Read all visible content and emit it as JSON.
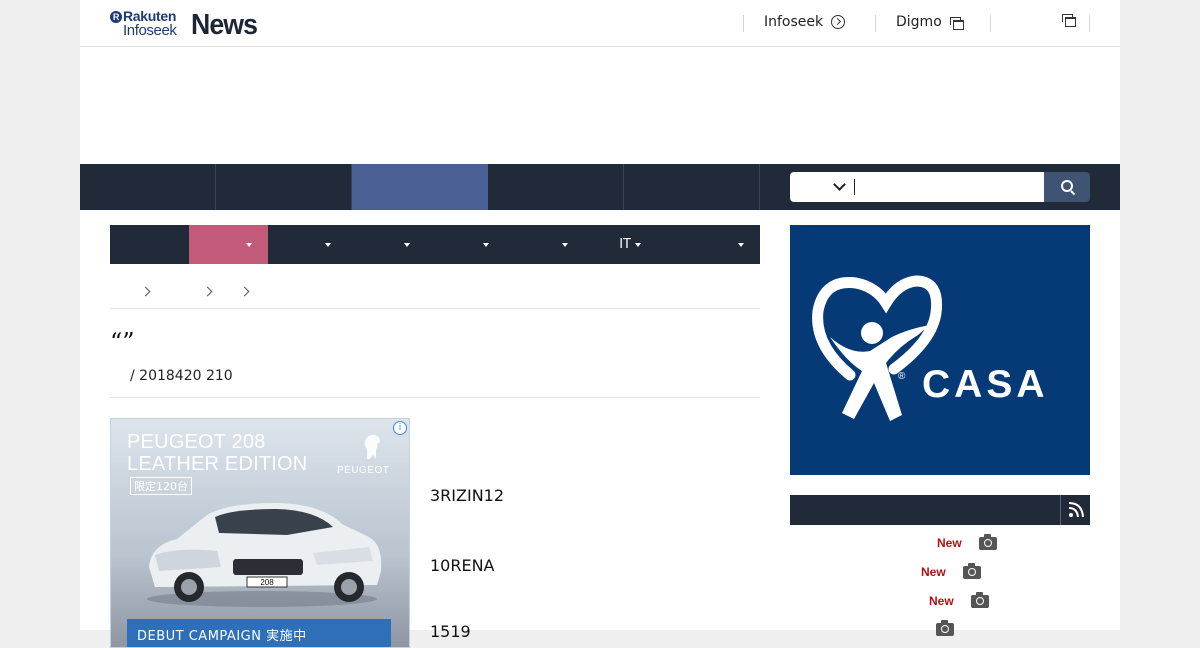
{
  "brand": {
    "rakuten": "Rakuten",
    "infoseek": "Infoseek",
    "news": "News"
  },
  "header": {
    "links": [
      {
        "label": "Infoseek",
        "icon": "circle-arrow-icon"
      },
      {
        "label": "Digmo",
        "icon": "external-window-icon"
      },
      {
        "label": "",
        "icon": "external-window-icon"
      }
    ]
  },
  "main_nav": {
    "tabs": [
      "",
      "",
      "",
      "",
      ""
    ],
    "active_index": 2
  },
  "search": {
    "placeholder": "",
    "selected_scope": ""
  },
  "sub_nav": {
    "items": [
      "",
      "",
      "",
      "",
      "",
      "",
      "IT",
      ""
    ],
    "active_index": 1
  },
  "breadcrumb": [
    "",
    "",
    "",
    ""
  ],
  "article": {
    "title": "“”",
    "byline": "/ 2018420 210",
    "paragraphs": [
      "3RIZIN12",
      "10RENA",
      "1519"
    ]
  },
  "ad": {
    "headline_1": "PEUGEOT 208",
    "headline_2": "LEATHER EDITION",
    "tag": "限定120台",
    "brand": "PEUGEOT",
    "plate": "208",
    "strip": "DEBUT CAMPAIGN 実施中"
  },
  "casa_ad": {
    "word": "CASA",
    "registered": "®"
  },
  "rss": {
    "title": "",
    "items": [
      {
        "badge": "New"
      },
      {
        "badge": "New"
      },
      {
        "badge": "New"
      },
      {
        "badge": ""
      }
    ]
  },
  "colors": {
    "nav_dark": "#212a38",
    "nav_active": "#4a5f93",
    "subnav_active": "#c25a7a",
    "casa_blue": "#063a76",
    "new_badge": "#b01212"
  }
}
